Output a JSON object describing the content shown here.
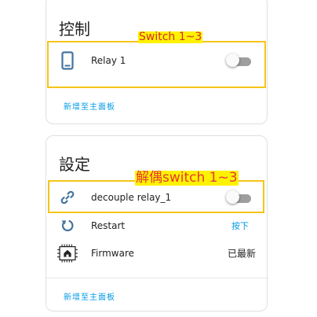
{
  "colors": {
    "accent": "#039be5",
    "icon": "#44739e",
    "annotation_border": "#f5c518",
    "annotation_fill": "#fff200",
    "annotation_text": "#e53935",
    "toggle_track": "#9e9e9e"
  },
  "control_card": {
    "title": "控制",
    "rows": [
      {
        "icon": "phone-icon",
        "label": "Relay 1",
        "toggle_on": false
      }
    ],
    "add_link": "新增至主面板"
  },
  "settings_card": {
    "title": "設定",
    "rows": [
      {
        "icon": "link-icon",
        "label": "decouple relay_1",
        "toggle_on": false
      },
      {
        "icon": "restart-icon",
        "label": "Restart",
        "action": "按下"
      },
      {
        "icon": "chip-icon",
        "label": "Firmware",
        "value": "已最新"
      }
    ],
    "add_link": "新增至主面板"
  },
  "annotations": {
    "switch_label": "Switch 1~3",
    "decouple_label": "解偶switch 1~3"
  }
}
